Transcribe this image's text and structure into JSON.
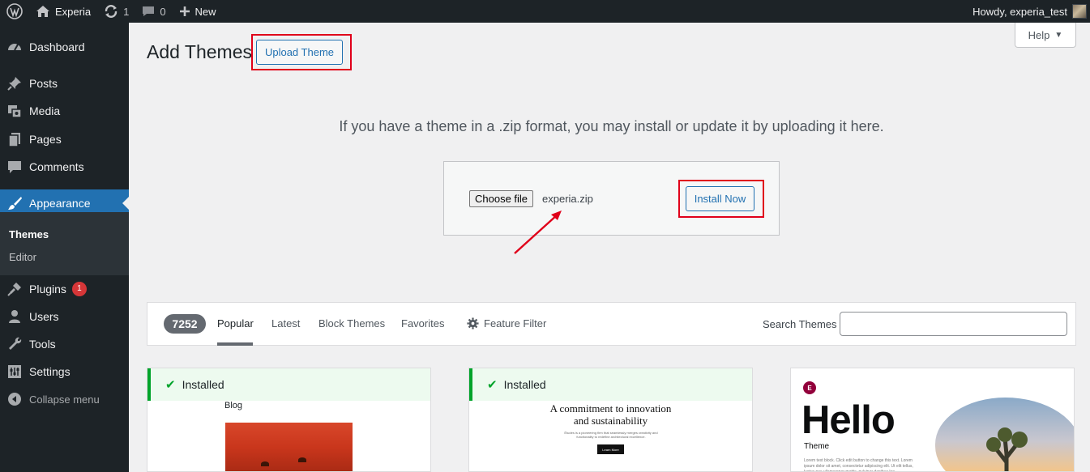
{
  "adminbar": {
    "site_name": "Experia",
    "updates_count": "1",
    "comments_count": "0",
    "new_label": "New",
    "greeting": "Howdy, experia_test"
  },
  "sidebar": {
    "items": [
      {
        "label": "Dashboard",
        "icon": "dashboard-icon"
      },
      {
        "label": "Posts",
        "icon": "pin-icon"
      },
      {
        "label": "Media",
        "icon": "media-icon"
      },
      {
        "label": "Pages",
        "icon": "pages-icon"
      },
      {
        "label": "Comments",
        "icon": "comment-icon"
      },
      {
        "label": "Appearance",
        "icon": "brush-icon"
      },
      {
        "label": "Plugins",
        "icon": "plugin-icon",
        "badge": "1"
      },
      {
        "label": "Users",
        "icon": "users-icon"
      },
      {
        "label": "Tools",
        "icon": "wrench-icon"
      },
      {
        "label": "Settings",
        "icon": "settings-icon"
      }
    ],
    "submenu": [
      "Themes",
      "Editor"
    ],
    "collapse_label": "Collapse menu"
  },
  "main": {
    "title": "Add Themes",
    "upload_button": "Upload Theme",
    "help_label": "Help",
    "upload_description": "If you have a theme in a .zip format, you may install or update it by uploading it here.",
    "choose_file_label": "Choose file",
    "file_name": "experia.zip",
    "install_button": "Install Now"
  },
  "filter": {
    "count": "7252",
    "tabs": [
      "Popular",
      "Latest",
      "Block Themes",
      "Favorites"
    ],
    "feature_filter": "Feature Filter",
    "search_label": "Search Themes",
    "search_value": ""
  },
  "themes": [
    {
      "status": "Installed",
      "preview_heading": "Blog"
    },
    {
      "status": "Installed",
      "preview_heading": "A commitment to innovation and sustainability",
      "preview_text": "Études is a pioneering firm that seamlessly merges creativity and functionality to redefine architectural excellence.",
      "preview_button": "Learn More"
    },
    {
      "preview_logo": "E",
      "preview_title": "Hello",
      "preview_subtitle": "Theme",
      "preview_text": "Lorem text block. Click edit button to change this text. Lorem ipsum dolor sit amet, consectetur adipiscing elit. Ut elit tellus, luctus nec ullamcorper mattis, pulvinar dapibus leo."
    }
  ],
  "colors": {
    "accent": "#2271b1",
    "adminbar_bg": "#1d2327",
    "highlight_box": "#e0001a",
    "installed_green": "#00a32a",
    "badge_red": "#d63638"
  }
}
